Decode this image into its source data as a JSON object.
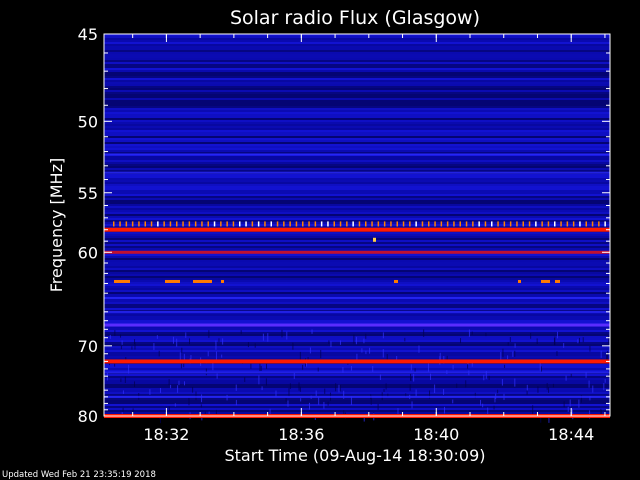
{
  "chart_data": {
    "type": "heatmap",
    "title": "Solar radio Flux (Glasgow)",
    "xlabel": "Start Time (09-Aug-14 18:30:09)",
    "ylabel": "Frequency [MHz]",
    "x_ticks": [
      "18:32",
      "18:36",
      "18:40",
      "18:44"
    ],
    "y_ticks": [
      {
        "label": "45",
        "value": 45
      },
      {
        "label": "50",
        "value": 50
      },
      {
        "label": "55",
        "value": 55
      },
      {
        "label": "60",
        "value": 60
      },
      {
        "label": "70",
        "value": 70
      },
      {
        "label": "80",
        "value": 80
      }
    ],
    "ylim": [
      45,
      80
    ],
    "y_scale": "reciprocal",
    "grid": false,
    "colors": {
      "background": "#0a0aa8",
      "low": "#000058",
      "mid": "#2020ff",
      "high": "#ff2000",
      "peak": "#ffe060"
    },
    "emission_bands_mhz": [
      {
        "frequency": 58.0,
        "intensity": "high"
      },
      {
        "frequency": 60.0,
        "intensity": "medium-high"
      },
      {
        "frequency": 67.5,
        "intensity": "medium"
      },
      {
        "frequency": 72.0,
        "intensity": "high"
      },
      {
        "frequency": 80.0,
        "intensity": "high"
      }
    ]
  },
  "footer": {
    "updated": "Updated Wed Feb 21 23:35:19 2018"
  }
}
